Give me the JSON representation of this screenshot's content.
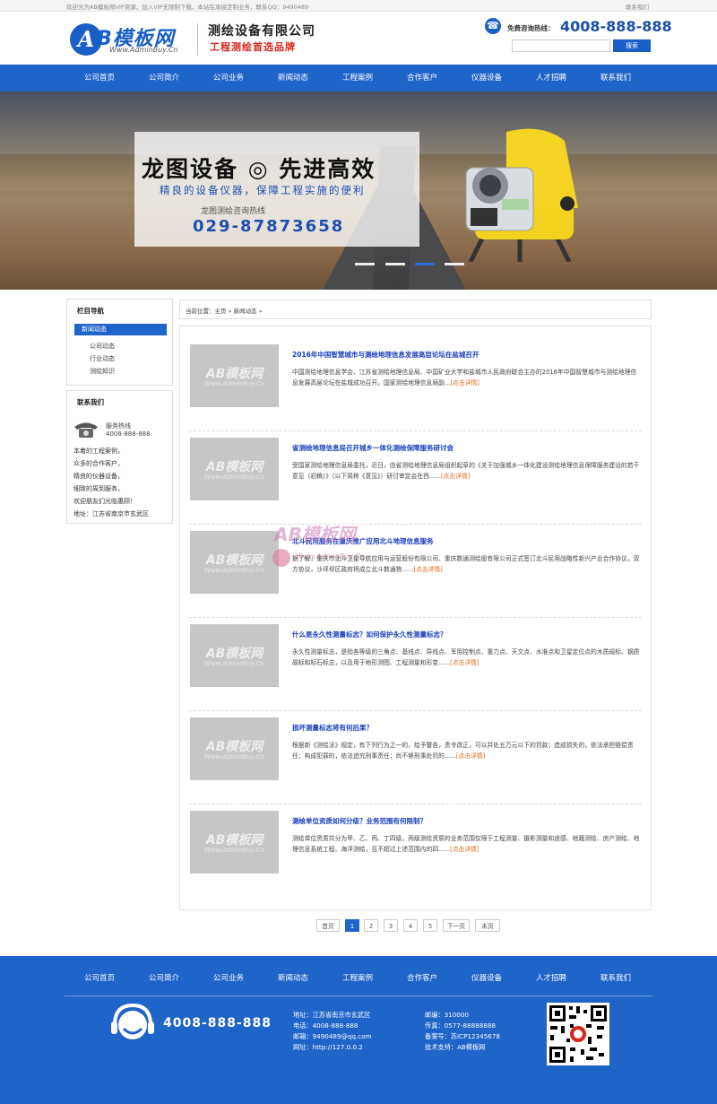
{
  "topbar": {
    "welcome": "欢迎光为AB模板网VIP资源，加入VIP无限制下载，本站在承接定制业务，联系QQ：9490489",
    "contact_link": "联系我们"
  },
  "header": {
    "logo_letter": "A",
    "logo_text": "B模板网",
    "logo_url": "Www.AdminBuy.Cn",
    "company_name": "测绘设备有限公司",
    "slogan": "工程测绘首选品牌",
    "hotline_label": "免费咨询热线：",
    "hotline_number": "4008-888-888",
    "search_placeholder": "",
    "search_button": "搜索"
  },
  "nav": [
    "公司首页",
    "公司简介",
    "公司业务",
    "新闻动态",
    "工程案例",
    "合作客户",
    "仪器设备",
    "人才招聘",
    "联系我们"
  ],
  "banner": {
    "title": "龙图设备 ◎ 先进高效",
    "subtitle": "精良的设备仪器，保障工程实施的便利",
    "line": "龙图测绘咨询热线",
    "phone": "029-87873658",
    "slide_count": 4,
    "active_slide": 3
  },
  "sidebar": {
    "nav_title": "栏目导航",
    "active_item": "新闻动态",
    "sub_items": [
      "公司动态",
      "行业动态",
      "测绘知识"
    ],
    "contact_title": "联系我们",
    "tel_label": "服务热线",
    "tel_number": "4008-888-888",
    "lines": [
      "本着的工程案例，",
      "众多的合作客户，",
      "精良的仪器设备，",
      "细致的周到服务，",
      "欢迎朋友们光临惠顾！",
      "地址：江苏省南京市玄武区"
    ]
  },
  "breadcrumb": "当前位置：主页 » 新闻动态 »",
  "thumb_text": {
    "big": "AB模板网",
    "small": "Www.AdminBuy.Cn"
  },
  "more_label": "[点击详情]",
  "articles": [
    {
      "title": "2016年中国智慧城市与测绘地理信息发展高层论坛在盐城召开",
      "desc": "中国测绘地理信息学会、江苏省测绘地理信息局、中国矿业大学和盐城市人民政府联合主办的2016年中国智慧城市与测绘地理信息发展高层论坛在盐城成功召开。国家测绘地理信息局副..."
    },
    {
      "title": "省测绘地理信息局召开城乡一体化测绘保障服务研讨会",
      "desc": "受国家测绘地理信息局委托，近日，由省测绘地理信息局组织起草的《关于加强城乡一体化建设测绘地理信息保障服务建设的若干意见（初稿）》（以下简称《意见》）研讨审定会在西......"
    },
    {
      "title": "北斗民用服务在重庆推广应用北斗地理信息服务",
      "desc": "据了解，重庆市北斗卫星导航应用与运营股份有限公司、重庆数通测绘股有限公司正式签订北斗民用战略性新兴产业合作协议，双方协议，沙坪坝区政府将成立北斗数通物......"
    },
    {
      "title": "什么是永久性测量标志？如何保护永久性测量标志？",
      "desc": "永久性测量标志，是指各等级的三角点、基线点、导线点、军用控制点、重力点、天文点、水准点和卫星定位点的木质觇标、钢质觇标和标石标志，以及用于地形测图、工程测量和形变......"
    },
    {
      "title": "损坏测量标志将有何后果？",
      "desc": "根据新《测绘法》规定，有下列行为之一的，给予警告，责令改正，可以并处五万元以下的罚款；造成损失的，依法承担赔偿责任；构成犯罪的，依法追究刑事责任；尚不够刑事处罚的......"
    },
    {
      "title": "测绘单位资质如何分级？业务范围有何限制？",
      "desc": "测绘单位资质共分为甲、乙、丙、丁四级。丙级测绘资质的业务范围仅限于工程测量、摄影测量和遥感、地籍测绘、房产测绘、地理信息系统工程、海洋测绘，且不超过上述范围内的四......"
    }
  ],
  "pagination": [
    "首页",
    "1",
    "2",
    "3",
    "4",
    "5",
    "下一页",
    "末页"
  ],
  "pagination_active": "1",
  "watermark": {
    "text": "AB模板网",
    "small": "Www.AdminBuy.Cn"
  },
  "footer": {
    "nav": [
      "公司首页",
      "公司简介",
      "公司业务",
      "新闻动态",
      "工程案例",
      "合作客户",
      "仪器设备",
      "人才招聘",
      "联系我们"
    ],
    "phone": "4008-888-888",
    "col1": [
      "地址：江苏省南京市玄武区",
      "电话：4008-888-888",
      "邮箱：9490489@qq.com",
      "网址：http://127.0.0.2"
    ],
    "col2": [
      "邮编：310000",
      "传真：0577-88888888",
      "备案号：苏ICP12345678",
      "技术支持：AB模板网"
    ]
  },
  "colors": {
    "brand": "#1f64c9",
    "accent_red": "#d9241c",
    "link_blue": "#1a3ec0",
    "more_orange": "#e8681b"
  }
}
